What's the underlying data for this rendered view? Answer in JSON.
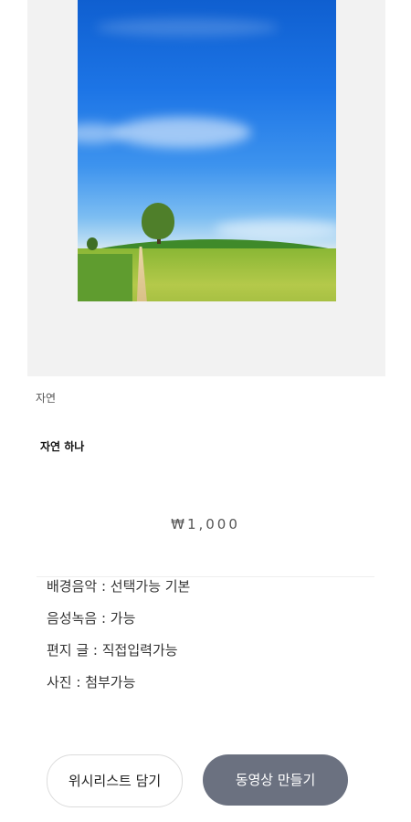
{
  "product": {
    "category": "자연",
    "title": "자연 하나",
    "price": "₩1,000"
  },
  "specs": [
    "배경음악 : 선택가능 기본",
    "음성녹음 : 가능",
    "편지 글 : 직접입력가능",
    "사진 : 첨부가능"
  ],
  "actions": {
    "wishlist_label": "위시리스트 담기",
    "make_video_label": "동영상 만들기"
  },
  "colors": {
    "primary_button": "#6b7180",
    "preview_background": "#f2f2f2"
  }
}
